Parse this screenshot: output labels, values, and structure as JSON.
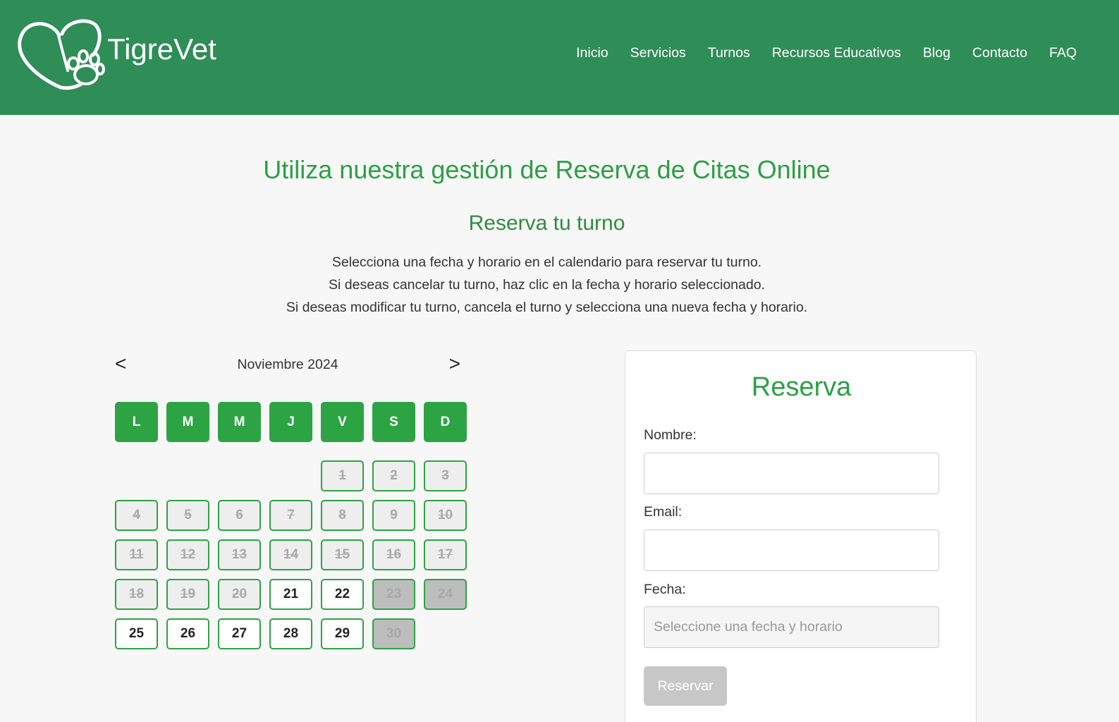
{
  "brand": {
    "name": "TigreVet"
  },
  "nav": {
    "items": [
      {
        "label": "Inicio"
      },
      {
        "label": "Servicios"
      },
      {
        "label": "Turnos"
      },
      {
        "label": "Recursos Educativos"
      },
      {
        "label": "Blog"
      },
      {
        "label": "Contacto"
      },
      {
        "label": "FAQ"
      }
    ]
  },
  "main": {
    "title": "Utiliza nuestra gestión de Reserva de Citas Online",
    "subtitle": "Reserva tu turno",
    "instructions": [
      "Selecciona una fecha y horario en el calendario para reservar tu turno.",
      "Si deseas cancelar tu turno, haz clic en la fecha y horario seleccionado.",
      "Si deseas modificar tu turno, cancela el turno y selecciona una nueva fecha y horario."
    ]
  },
  "calendar": {
    "prev_label": "<",
    "next_label": ">",
    "month_label": "Noviembre 2024",
    "weekdays": [
      "L",
      "M",
      "M",
      "J",
      "V",
      "S",
      "D"
    ],
    "days": [
      {
        "d": "1",
        "state": "past"
      },
      {
        "d": "2",
        "state": "past"
      },
      {
        "d": "3",
        "state": "past"
      },
      {
        "d": "4",
        "state": "past"
      },
      {
        "d": "5",
        "state": "past"
      },
      {
        "d": "6",
        "state": "past"
      },
      {
        "d": "7",
        "state": "past"
      },
      {
        "d": "8",
        "state": "past"
      },
      {
        "d": "9",
        "state": "past"
      },
      {
        "d": "10",
        "state": "past"
      },
      {
        "d": "11",
        "state": "past"
      },
      {
        "d": "12",
        "state": "past"
      },
      {
        "d": "13",
        "state": "past"
      },
      {
        "d": "14",
        "state": "past"
      },
      {
        "d": "15",
        "state": "past"
      },
      {
        "d": "16",
        "state": "past"
      },
      {
        "d": "17",
        "state": "past"
      },
      {
        "d": "18",
        "state": "past"
      },
      {
        "d": "19",
        "state": "past"
      },
      {
        "d": "20",
        "state": "past"
      },
      {
        "d": "21",
        "state": "avail"
      },
      {
        "d": "22",
        "state": "avail"
      },
      {
        "d": "23",
        "state": "weekend"
      },
      {
        "d": "24",
        "state": "weekend"
      },
      {
        "d": "25",
        "state": "avail"
      },
      {
        "d": "26",
        "state": "avail"
      },
      {
        "d": "27",
        "state": "avail"
      },
      {
        "d": "28",
        "state": "avail"
      },
      {
        "d": "29",
        "state": "avail"
      },
      {
        "d": "30",
        "state": "weekend"
      }
    ],
    "colors": {
      "accent": "#2ca444",
      "past_bg": "#eeeeee",
      "weekend_bg": "#bdbdbd"
    }
  },
  "form": {
    "title": "Reserva",
    "name_label": "Nombre:",
    "name_value": "",
    "email_label": "Email:",
    "email_value": "",
    "date_label": "Fecha:",
    "date_placeholder": "Seleccione una fecha y horario",
    "submit_label": "Reservar"
  },
  "colors": {
    "header_bg": "#2f8d57",
    "accent": "#2ca044",
    "page_bg": "#f7f7f7"
  }
}
